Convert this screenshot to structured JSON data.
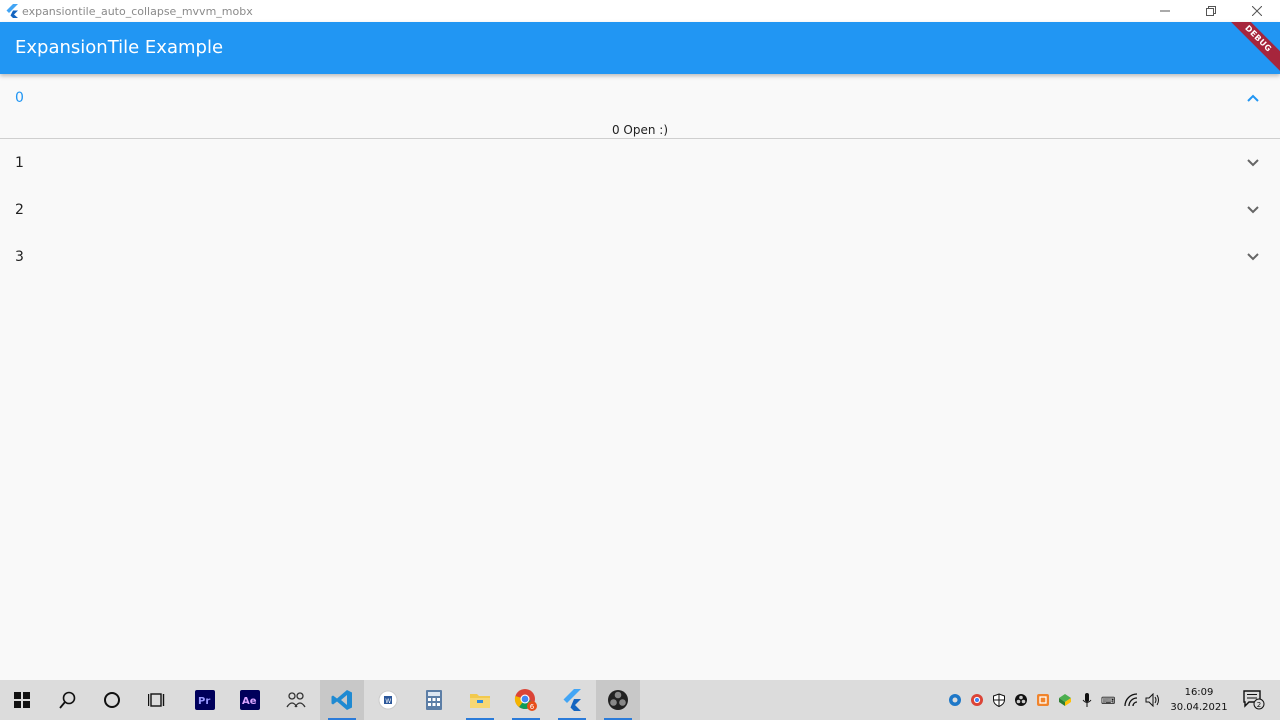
{
  "window": {
    "title": "expansiontile_auto_collapse_mvvm_mobx",
    "controls": [
      "minimize-icon",
      "restore-icon",
      "close-icon"
    ]
  },
  "appbar": {
    "title": "ExpansionTile Example",
    "debug_banner": "DEBUG",
    "color": "#2196f3"
  },
  "tiles": [
    {
      "label": "0",
      "expanded": true,
      "content": "0 Open :)"
    },
    {
      "label": "1",
      "expanded": false
    },
    {
      "label": "2",
      "expanded": false
    },
    {
      "label": "3",
      "expanded": false
    }
  ],
  "taskbar": {
    "apps": [
      "windows-start-icon",
      "search-icon",
      "cortana-icon",
      "task-view-icon",
      "premiere-pro-icon",
      "after-effects-icon",
      "people-icon",
      "vscode-icon",
      "word-icon",
      "calculator-icon",
      "file-explorer-icon",
      "chrome-icon",
      "flutter-icon",
      "obs-icon"
    ],
    "chrome_badge": "6",
    "clock": {
      "time": "16:09",
      "date": "30.04.2021"
    },
    "notification_count": "2"
  }
}
